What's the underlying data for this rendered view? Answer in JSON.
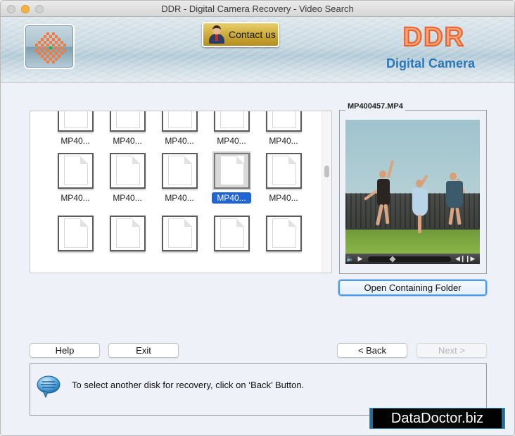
{
  "window": {
    "title": "DDR - Digital Camera Recovery - Video Search"
  },
  "banner": {
    "contact_label": "Contact us",
    "brand_title": "DDR",
    "brand_subtitle": "Digital Camera"
  },
  "files": {
    "items": [
      {
        "label": "MP40...",
        "selected": false
      },
      {
        "label": "MP40...",
        "selected": false
      },
      {
        "label": "MP40...",
        "selected": false
      },
      {
        "label": "MP40...",
        "selected": false
      },
      {
        "label": "MP40...",
        "selected": false
      },
      {
        "label": "MP40...",
        "selected": false
      },
      {
        "label": "MP40...",
        "selected": false
      },
      {
        "label": "MP40...",
        "selected": false
      },
      {
        "label": "MP40...",
        "selected": true
      },
      {
        "label": "MP40...",
        "selected": false
      },
      {
        "label": "",
        "selected": false
      },
      {
        "label": "",
        "selected": false
      },
      {
        "label": "",
        "selected": false
      },
      {
        "label": "",
        "selected": false
      },
      {
        "label": "",
        "selected": false
      }
    ]
  },
  "preview": {
    "filename": "MP400457.MP4",
    "seek_position_fraction": 0.3,
    "controls": {
      "volume_icon": "🔈",
      "play_icon": "▶",
      "prev_icon": "◀❙",
      "next_icon": "❙▶"
    },
    "open_folder_label": "Open Containing Folder"
  },
  "buttons": {
    "help": "Help",
    "exit": "Exit",
    "back": "< Back",
    "next": "Next >"
  },
  "info": {
    "message": "To select another disk for recovery, click on ‘Back’ Button."
  },
  "watermark": "DataDoctor.biz",
  "colors": {
    "accent": "#2065d3",
    "logo_orange": "#f47a3c",
    "logo_green": "#2eae3a"
  }
}
